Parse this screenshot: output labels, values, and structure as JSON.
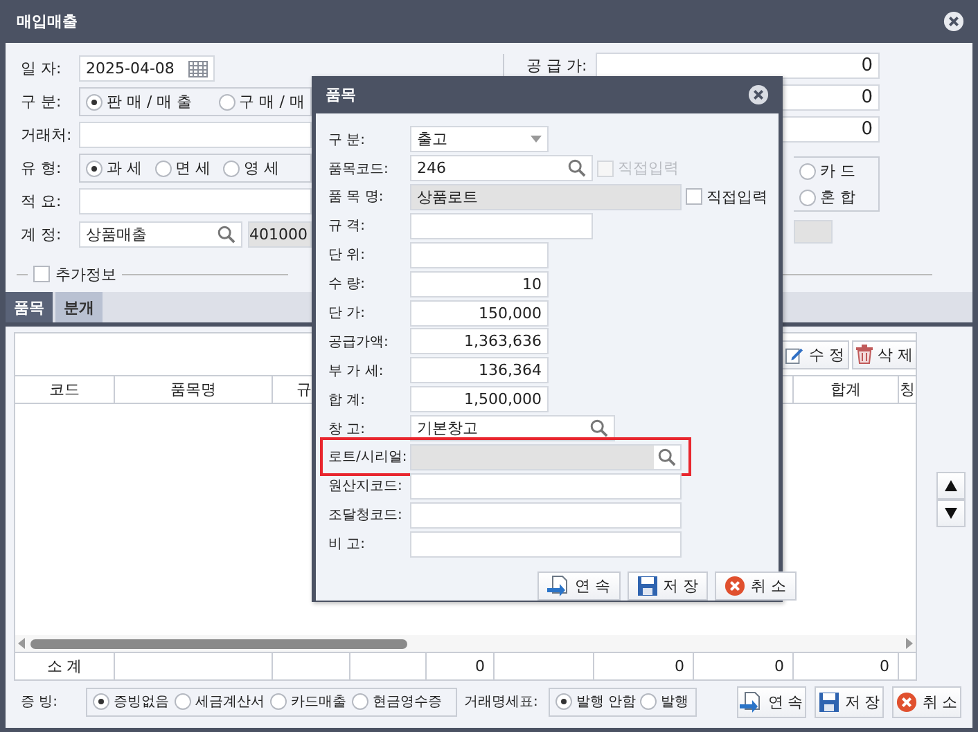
{
  "window": {
    "title": "매입매출"
  },
  "form": {
    "date": {
      "label": "일 자:",
      "value": "2025-04-08"
    },
    "category": {
      "label": "구 분:",
      "options": [
        {
          "label": "판 매 / 매 출",
          "selected": true
        },
        {
          "label": "구 매 / 매",
          "selected": false
        }
      ]
    },
    "client": {
      "label": "거래처:"
    },
    "tax_type": {
      "label": "유 형:",
      "options": [
        {
          "label": "과 세",
          "selected": true
        },
        {
          "label": "면 세",
          "selected": false
        },
        {
          "label": "영 세",
          "selected": false
        }
      ]
    },
    "memo": {
      "label": "적 요:"
    },
    "account": {
      "label": "계 정:",
      "value": "상품매출",
      "code": "401000"
    }
  },
  "amounts": {
    "rows": [
      {
        "label": "공 급 가:",
        "value": "0"
      },
      {
        "value": "0"
      },
      {
        "value": "0"
      }
    ],
    "payment_options": [
      {
        "label": "카 드",
        "selected": false
      },
      {
        "label": "혼 합",
        "selected": false
      }
    ]
  },
  "extra_info": {
    "label": "추가정보",
    "checked": false
  },
  "tabs": [
    {
      "label": "품목",
      "selected": true
    },
    {
      "label": "분개",
      "selected": false
    }
  ],
  "toolbar": [
    {
      "kind": "edit",
      "label": "수 정"
    },
    {
      "kind": "delete",
      "label": "삭 제"
    }
  ],
  "table": {
    "columns": [
      "코드",
      "품목명",
      "규",
      "합계",
      "칭"
    ],
    "subtotal": {
      "label": "소 계",
      "values": [
        "0",
        "0",
        "0",
        "0"
      ]
    }
  },
  "evidence": {
    "label": "증 빙:",
    "options": [
      {
        "label": "증빙없음",
        "selected": true
      },
      {
        "label": "세금계산서",
        "selected": false
      },
      {
        "label": "카드매출",
        "selected": false
      },
      {
        "label": "현금영수증",
        "selected": false
      }
    ]
  },
  "statement": {
    "label": "거래명세표:",
    "options": [
      {
        "label": "발행 안함",
        "selected": true
      },
      {
        "label": "발행",
        "selected": false
      }
    ]
  },
  "buttons": [
    {
      "kind": "continue",
      "label": "연 속"
    },
    {
      "kind": "save",
      "label": "저 장"
    },
    {
      "kind": "cancel",
      "label": "취 소"
    }
  ],
  "dialog": {
    "title": "품목",
    "fields": [
      {
        "kind": "select",
        "label": "구 분:",
        "value": "출고"
      },
      {
        "kind": "code-search",
        "label": "품목코드:",
        "value": "246",
        "checkbox": {
          "label": "직접입력",
          "checked": false,
          "disabled": true
        }
      },
      {
        "kind": "name",
        "label": "품 목 명:",
        "value": "상품로트",
        "checkbox": {
          "label": "직접입력",
          "checked": false,
          "disabled": false
        }
      },
      {
        "kind": "text-medium",
        "label": "규 격:"
      },
      {
        "kind": "text-short",
        "label": "단 위:"
      },
      {
        "kind": "number",
        "label": "수 량:",
        "value": "10"
      },
      {
        "kind": "number",
        "label": "단 가:",
        "value": "150,000"
      },
      {
        "kind": "number",
        "label": "공급가액:",
        "value": "1,363,636"
      },
      {
        "kind": "number",
        "label": "부 가 세:",
        "value": "136,364"
      },
      {
        "kind": "number",
        "label": "합 계:",
        "value": "1,500,000"
      },
      {
        "kind": "store-search",
        "label": "창 고:",
        "value": "기본창고"
      },
      {
        "kind": "lot-search",
        "label": "로트/시리얼:",
        "highlighted": true
      },
      {
        "kind": "text-wide",
        "label": "원산지코드:"
      },
      {
        "kind": "text-wide",
        "label": "조달청코드:"
      },
      {
        "kind": "text-wide",
        "label": "비 고:"
      }
    ],
    "buttons": [
      {
        "kind": "continue",
        "label": "연 속"
      },
      {
        "kind": "save",
        "label": "저 장"
      },
      {
        "kind": "cancel",
        "label": "취 소"
      }
    ]
  }
}
